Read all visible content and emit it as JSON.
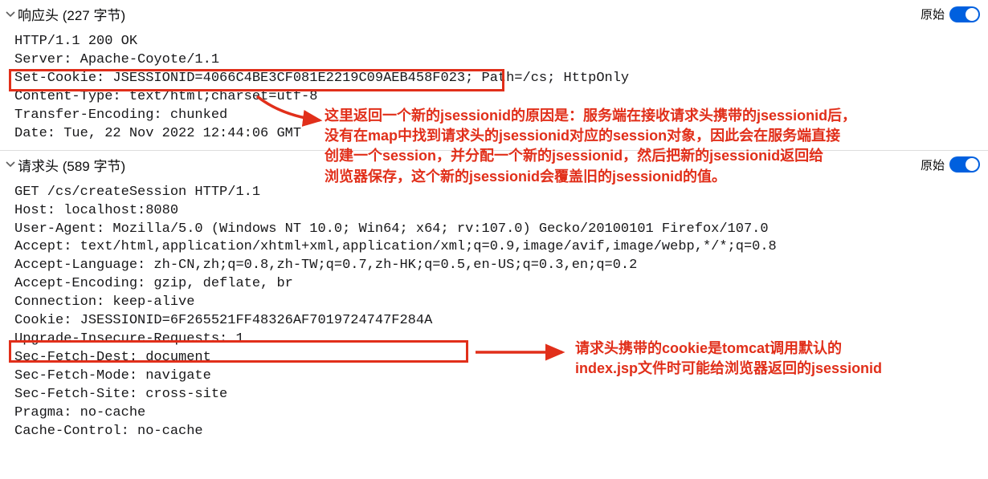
{
  "response": {
    "title": "响应头 (227 字节)",
    "raw_label": "原始",
    "lines": [
      "HTTP/1.1 200 OK",
      "Server: Apache-Coyote/1.1",
      "Set-Cookie: JSESSIONID=4066C4BE3CF081E2219C09AEB458F023; Path=/cs; HttpOnly",
      "Content-Type: text/html;charset=utf-8",
      "Transfer-Encoding: chunked",
      "Date: Tue, 22 Nov 2022 12:44:06 GMT"
    ]
  },
  "request": {
    "title": "请求头 (589 字节)",
    "raw_label": "原始",
    "lines": [
      "GET /cs/createSession HTTP/1.1",
      "Host: localhost:8080",
      "User-Agent: Mozilla/5.0 (Windows NT 10.0; Win64; x64; rv:107.0) Gecko/20100101 Firefox/107.0",
      "Accept: text/html,application/xhtml+xml,application/xml;q=0.9,image/avif,image/webp,*/*;q=0.8",
      "Accept-Language: zh-CN,zh;q=0.8,zh-TW;q=0.7,zh-HK;q=0.5,en-US;q=0.3,en;q=0.2",
      "Accept-Encoding: gzip, deflate, br",
      "Connection: keep-alive",
      "Cookie: JSESSIONID=6F265521FF48326AF7019724747F284A",
      "Upgrade-Insecure-Requests: 1",
      "Sec-Fetch-Dest: document",
      "Sec-Fetch-Mode: navigate",
      "Sec-Fetch-Site: cross-site",
      "Pragma: no-cache",
      "Cache-Control: no-cache"
    ]
  },
  "annotations": {
    "top": "这里返回一个新的jsessionid的原因是：服务端在接收请求头携带的jsessionid后，\n没有在map中找到请求头的jsessionid对应的session对象，因此会在服务端直接\n创建一个session，并分配一个新的jsessionid，然后把新的jsessionid返回给\n浏览器保存，这个新的jsessionid会覆盖旧的jsessionid的值。",
    "bottom": "请求头携带的cookie是tomcat调用默认的\nindex.jsp文件时可能给浏览器返回的jsessionid"
  }
}
